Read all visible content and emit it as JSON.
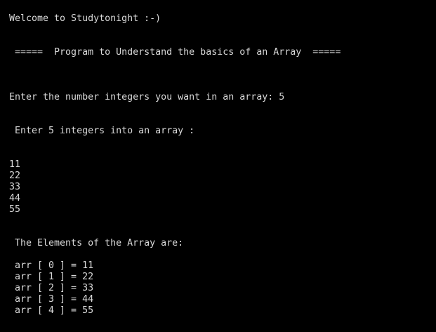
{
  "terminal": {
    "colors": {
      "background": "#000000",
      "foreground": "#d9d9d9"
    },
    "welcome": "Welcome to Studytonight :-)",
    "banner": " =====  Program to Understand the basics of an Array  =====",
    "prompt_count": "Enter the number integers you want in an array: 5",
    "prompt_values": " Enter 5 integers into an array :",
    "inputs": [
      "11",
      "22",
      "33",
      "44",
      "55"
    ],
    "elements_heading": " The Elements of the Array are:",
    "elements": [
      " arr [ 0 ] = 11",
      " arr [ 1 ] = 22",
      " arr [ 2 ] = 33",
      " arr [ 3 ] = 44",
      " arr [ 4 ] = 55"
    ]
  }
}
